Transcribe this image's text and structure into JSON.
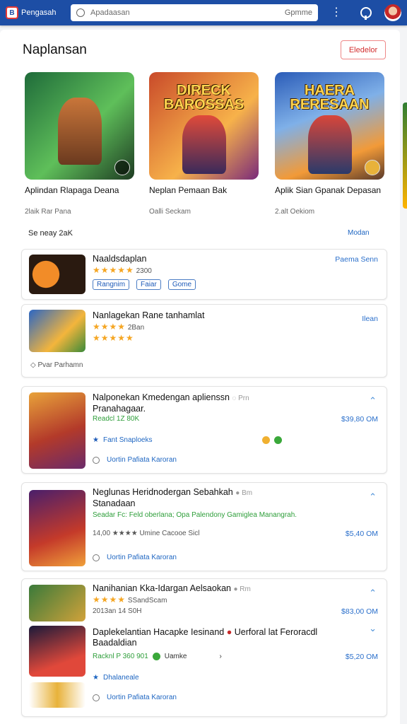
{
  "topbar": {
    "logo_text": "Pengasah",
    "search_placeholder": "Apadaasan",
    "search_button": "Gpmme"
  },
  "section": {
    "title": "Naplansan",
    "see_all": "Eledelor"
  },
  "featured": [
    {
      "logo": "",
      "name": "Aplindan Rlapaga Deana",
      "sub": "2laik Rar Pana",
      "colors": [
        "#1f6b3a",
        "#8bd36b"
      ]
    },
    {
      "logo": "DIRECK BAROSSAS",
      "name": "Neplan Pemaan Bak",
      "sub": "Oalli Seckam",
      "colors": [
        "#c94a2a",
        "#f7b24a"
      ]
    },
    {
      "logo": "HAERA RERESAAN",
      "name": "Aplik Sian Gpanak Depasan",
      "sub": "2.alt Oekiom",
      "colors": [
        "#2b5cb8",
        "#f29a38"
      ]
    }
  ],
  "list_header": {
    "sort_label": "Se neay 2aK",
    "more": "Modan"
  },
  "cards": [
    {
      "title": "Naaldsdaplan",
      "stars": "★★★★★",
      "rating_text": "2300",
      "chips": [
        "Rangnim",
        "Faiar",
        "Gome"
      ],
      "right": "Paema Senn",
      "thumb_colors": [
        "#2a1a10",
        "#f28c28"
      ]
    },
    {
      "title": "Nanlagekan Rane tanhamlat",
      "stars": "★★★★",
      "stars2": "★★★★★",
      "rating_text": "2Ban",
      "sub": "Pvar Parhamn",
      "right": "Ilean",
      "thumb_colors": [
        "#2b66c4",
        "#f3b53c"
      ]
    },
    {
      "title": "Nalponekan Kmedengan aplienssn",
      "title2": "Pranahagaar.",
      "badge": "Prn",
      "green_text": "Readcl 1Z  80K",
      "tags": "Fant  Snaploeks",
      "price": "$39,80 OM",
      "footer": "Uortin   Pafiata   Karoran",
      "thumb_colors": [
        "#e8a23a",
        "#b33a2a"
      ]
    },
    {
      "title": "Neglunas Heridnodergan Sebahkah",
      "title2": "Stanadaan",
      "badge": "Bm",
      "line": "Seadar Fc: Feld oberlana; Opa Palendony Gamiglea Manangrah.",
      "meta": "14,00  ★★★★   Umine Cacooe Sicl",
      "price": "$5,40 OM",
      "footer": "Uortin   Pafiata   Karoran",
      "thumb_colors": [
        "#4a1f6b",
        "#c43a2a"
      ]
    },
    {
      "title": "Nanihanian Kka-Idargan Aelsaokan",
      "badge": "Rm",
      "stars": "★★★★",
      "stars_label": "SSandScam",
      "meta": "2013an 14  S0H",
      "price": "$83,00 OM",
      "title_b": "Daplekelantian Hacapke Iesinand",
      "title_b2": "Baadaldian",
      "title_b_tail": "Uerforal lat Feroracdl",
      "green_b": "Racknl P  360 901",
      "mid_b": "Uamke",
      "price_b": "$5,20 OM",
      "tags_b": "Dhalaneale",
      "footer": "Uortin   Pafiata   Karoran",
      "thumb_colors": [
        "#3a7a3a",
        "#d1a23a"
      ],
      "thumb_colors_b": [
        "#1a1a3a",
        "#e0483a"
      ]
    }
  ]
}
